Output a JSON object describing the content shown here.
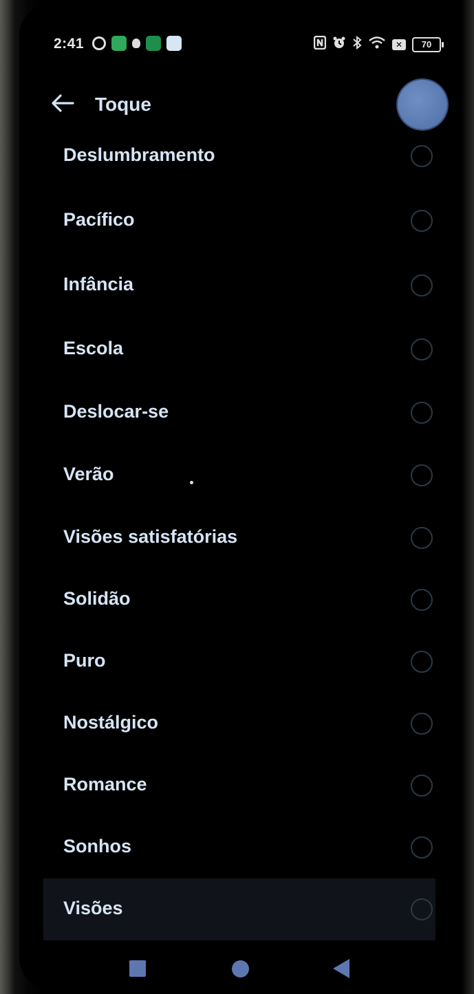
{
  "status_bar": {
    "time": "2:41",
    "battery": "70",
    "left_icons": [
      "vpn-icon",
      "app-green-icon",
      "android-icon",
      "app-green2-icon",
      "app-blue-icon"
    ],
    "right_icons": [
      "nfc-icon",
      "alarm-icon",
      "bluetooth-icon",
      "wifi-icon",
      "sim-off-icon",
      "battery-icon"
    ]
  },
  "header": {
    "title": "Toque",
    "back_icon": "back-arrow-icon"
  },
  "ringtones": [
    {
      "label": "Deslumbramento",
      "selected": false
    },
    {
      "label": "Pacífico",
      "selected": false
    },
    {
      "label": "Infância",
      "selected": false
    },
    {
      "label": "Escola",
      "selected": false
    },
    {
      "label": "Deslocar-se",
      "selected": false
    },
    {
      "label": "Verão",
      "selected": false
    },
    {
      "label": "Visões satisfatórias",
      "selected": false
    },
    {
      "label": "Solidão",
      "selected": false
    },
    {
      "label": "Puro",
      "selected": false
    },
    {
      "label": "Nostálgico",
      "selected": false
    },
    {
      "label": "Romance",
      "selected": false
    },
    {
      "label": "Sonhos",
      "selected": false
    },
    {
      "label": "Visões",
      "selected": false
    }
  ],
  "nav_bar": {
    "icons": [
      "recents-square-icon",
      "home-circle-icon",
      "back-triangle-icon"
    ]
  },
  "colors": {
    "text": "#d6e4f5",
    "accent": "#5d78b0",
    "background": "#000000"
  }
}
